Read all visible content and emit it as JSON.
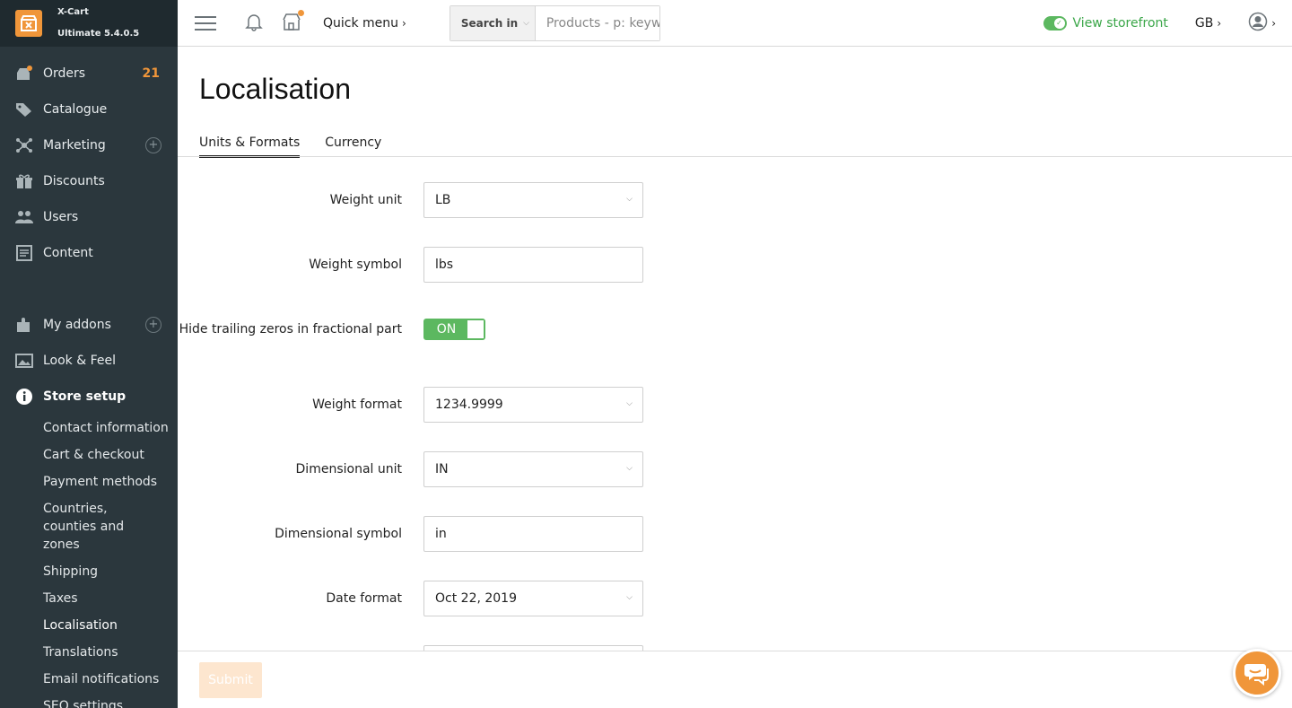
{
  "brand": {
    "name": "X-Cart",
    "version": "Ultimate 5.4.0.5"
  },
  "sidebar": {
    "items": [
      {
        "label": "Orders",
        "count": "21"
      },
      {
        "label": "Catalogue"
      },
      {
        "label": "Marketing"
      },
      {
        "label": "Discounts"
      },
      {
        "label": "Users"
      },
      {
        "label": "Content"
      },
      {
        "label": "My addons"
      },
      {
        "label": "Look & Feel"
      },
      {
        "label": "Store setup"
      }
    ],
    "store_setup_sub": [
      "Contact information",
      "Cart & checkout",
      "Payment methods",
      "Countries, counties and zones",
      "Shipping",
      "Taxes",
      "Localisation",
      "Translations",
      "Email notifications",
      "SEO settings"
    ]
  },
  "topbar": {
    "quick_menu": "Quick menu",
    "search_in": "Search in",
    "search_placeholder": "Products - p: keyword",
    "view_storefront": "View storefront",
    "language": "GB"
  },
  "page": {
    "title": "Localisation",
    "tabs": [
      "Units & Formats",
      "Currency"
    ]
  },
  "form": {
    "weight_unit": {
      "label": "Weight unit",
      "value": "LB"
    },
    "weight_symbol": {
      "label": "Weight symbol",
      "value": "lbs"
    },
    "hide_zeros": {
      "label": "Hide trailing zeros in fractional part",
      "value": "ON"
    },
    "weight_format": {
      "label": "Weight format",
      "value": "1234.9999"
    },
    "dim_unit": {
      "label": "Dimensional unit",
      "value": "IN"
    },
    "dim_symbol": {
      "label": "Dimensional symbol",
      "value": "in"
    },
    "date_format": {
      "label": "Date format",
      "value": "Oct 22, 2019"
    }
  },
  "footer": {
    "submit": "Submit"
  },
  "colors": {
    "accent": "#f0963a",
    "sidebar": "#2b373d",
    "success": "#5cb860"
  }
}
